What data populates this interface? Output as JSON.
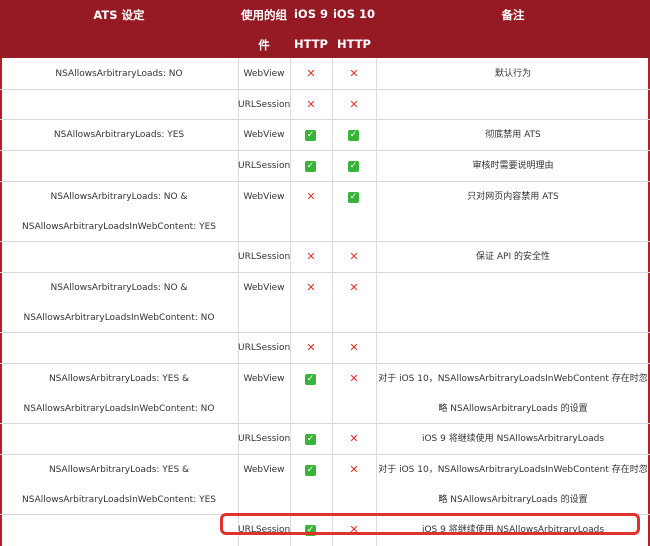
{
  "header": {
    "setting": "ATS 设定",
    "component_line1": "使用的组",
    "component_line2": "件",
    "ios9_line1": "iOS 9",
    "ios9_line2": "HTTP",
    "ios10_line1": "iOS 10",
    "ios10_line2": "HTTP",
    "remark": "备注"
  },
  "icons": {
    "allowed": "check-icon",
    "blocked": "cross-icon",
    "check_color": "#37b43a",
    "cross_color": "#e0322c"
  },
  "rows": [
    {
      "setting_line1": "NSAllowsArbitraryLoads: NO",
      "setting_line2": "",
      "component": "WebView",
      "ios9": "blocked",
      "ios10": "blocked",
      "remark_line1": "默认行为",
      "remark_line2": ""
    },
    {
      "setting_line1": "",
      "setting_line2": "",
      "component": "URLSession",
      "ios9": "blocked",
      "ios10": "blocked",
      "remark_line1": "",
      "remark_line2": ""
    },
    {
      "setting_line1": "NSAllowsArbitraryLoads: YES",
      "setting_line2": "",
      "component": "WebView",
      "ios9": "allowed",
      "ios10": "allowed",
      "remark_line1": "彻底禁用 ATS",
      "remark_line2": ""
    },
    {
      "setting_line1": "",
      "setting_line2": "",
      "component": "URLSession",
      "ios9": "allowed",
      "ios10": "allowed",
      "remark_line1": "审核时需要说明理由",
      "remark_line2": ""
    },
    {
      "setting_line1": "NSAllowsArbitraryLoads: NO &",
      "setting_line2": "NSAllowsArbitraryLoadsInWebContent: YES",
      "component": "WebView",
      "ios9": "blocked",
      "ios10": "allowed",
      "remark_line1": "只对网页内容禁用 ATS",
      "remark_line2": ""
    },
    {
      "setting_line1": "",
      "setting_line2": "",
      "component": "URLSession",
      "ios9": "blocked",
      "ios10": "blocked",
      "remark_line1": "保证 API 的安全性",
      "remark_line2": ""
    },
    {
      "setting_line1": "NSAllowsArbitraryLoads: NO &",
      "setting_line2": "NSAllowsArbitraryLoadsInWebContent: NO",
      "component": "WebView",
      "ios9": "blocked",
      "ios10": "blocked",
      "remark_line1": "",
      "remark_line2": ""
    },
    {
      "setting_line1": "",
      "setting_line2": "",
      "component": "URLSession",
      "ios9": "blocked",
      "ios10": "blocked",
      "remark_line1": "",
      "remark_line2": ""
    },
    {
      "setting_line1": "NSAllowsArbitraryLoads: YES &",
      "setting_line2": "NSAllowsArbitraryLoadsInWebContent: NO",
      "component": "WebView",
      "ios9": "allowed",
      "ios10": "blocked",
      "remark_line1": "对于 iOS 10，NSAllowsArbitraryLoadsInWebContent 存在时忽",
      "remark_line2": "略 NSAllowsArbitraryLoads 的设置"
    },
    {
      "setting_line1": "",
      "setting_line2": "",
      "component": "URLSession",
      "ios9": "allowed",
      "ios10": "blocked",
      "remark_line1": "iOS 9 将继续使用 NSAllowsArbitraryLoads",
      "remark_line2": ""
    },
    {
      "setting_line1": "NSAllowsArbitraryLoads: YES &",
      "setting_line2": "NSAllowsArbitraryLoadsInWebContent: YES",
      "component": "WebView",
      "ios9": "allowed",
      "ios10": "blocked",
      "remark_line1": "对于 iOS 10，NSAllowsArbitraryLoadsInWebContent 存在时忽",
      "remark_line2": "略 NSAllowsArbitraryLoads 的设置"
    },
    {
      "setting_line1": "",
      "setting_line2": "",
      "component": "URLSession",
      "ios9": "allowed",
      "ios10": "blocked",
      "remark_line1": "iOS 9 将继续使用 NSAllowsArbitraryLoads",
      "remark_line2": ""
    }
  ]
}
